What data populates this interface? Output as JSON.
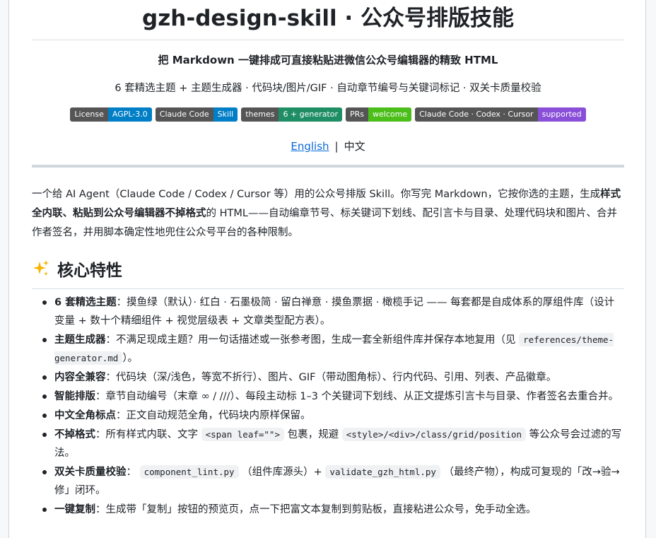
{
  "title": "gzh-design-skill · 公众号排版技能",
  "tagline": "把 Markdown 一键排成可直接粘贴进微信公众号编辑器的精致 HTML",
  "subline": "6 套精选主题 + 主题生成器 · 代码块/图片/GIF · 自动章节编号与关键词标记 · 双关卡质量校验",
  "badges": [
    {
      "label": "License",
      "value": "AGPL-3.0",
      "color": "#007ec6"
    },
    {
      "label": "Claude Code",
      "value": "Skill",
      "color": "#007ec6"
    },
    {
      "label": "themes",
      "value": "6 + generator",
      "color": "#1f8e64"
    },
    {
      "label": "PRs",
      "value": "welcome",
      "color": "#4bbe1a"
    },
    {
      "label": "Claude Code · Codex · Cursor",
      "value": "supported",
      "color": "#8a4fd8"
    }
  ],
  "lang": {
    "english": "English",
    "separator": "|",
    "chinese": "中文"
  },
  "intro": {
    "part1": "一个给 AI Agent（Claude Code / Codex / Cursor 等）用的公众号排版 Skill。你写完 Markdown，它按你选的主题，生成",
    "bold": "样式全内联、粘贴到公众号编辑器不掉格式",
    "part2": "的 HTML——自动编章节号、标关键词下划线、配引言卡与目录、处理代码块和图片、合并作者签名，并用脚本确定性地兜住公众号平台的各种限制。"
  },
  "section": {
    "title": "核心特性",
    "icon": "sparkles-icon"
  },
  "features": {
    "f1": {
      "bold": "6 套精选主题",
      "text": "：摸鱼绿（默认）· 红白 · 石墨极简 · 留白禅意 · 摸鱼票据 · 橄榄手记 —— 每套都是自成体系的厚组件库（设计变量 + 数十个精细组件 + 视觉层级表 + 文章类型配方表）。"
    },
    "f2": {
      "bold": "主题生成器",
      "text": "：不满足现成主题？用一句话描述或一张参考图，生成一套全新组件库并保存本地复用（见",
      "code": "references/theme-generator.md",
      "tail": "）。"
    },
    "f3": {
      "bold": "内容全兼容",
      "text": "：代码块（深/浅色，等宽不折行）、图片、GIF（带动图角标）、行内代码、引用、列表、产品徽章。"
    },
    "f4": {
      "bold": "智能排版",
      "text": "：章节自动编号（末章 ∞ / ///）、每段主动标 1–3 个关键词下划线、从正文提炼引言卡与目录、作者签名去重合并。"
    },
    "f5": {
      "bold": "中文全角标点",
      "text": "：正文自动规范全角，代码块内原样保留。"
    },
    "f6": {
      "bold": "不掉格式",
      "text": "：所有样式内联、文字",
      "code1": "<span leaf=\"\">",
      "mid": "包裹，规避",
      "code2": "<style>/<div>/class/grid/position",
      "tail": "等公众号会过滤的写法。"
    },
    "f7": {
      "bold": "双关卡质量校验",
      "text": "：",
      "code1": "component_lint.py",
      "mid": "（组件库源头）+",
      "code2": "validate_gzh_html.py",
      "tail": "（最终产物），构成可复现的「改→验→修」闭环。"
    },
    "f8": {
      "bold": "一键复制",
      "text": "：生成带「复制」按钮的预览页，点一下把富文本复制到剪贴板，直接粘进公众号，免手动全选。"
    }
  }
}
